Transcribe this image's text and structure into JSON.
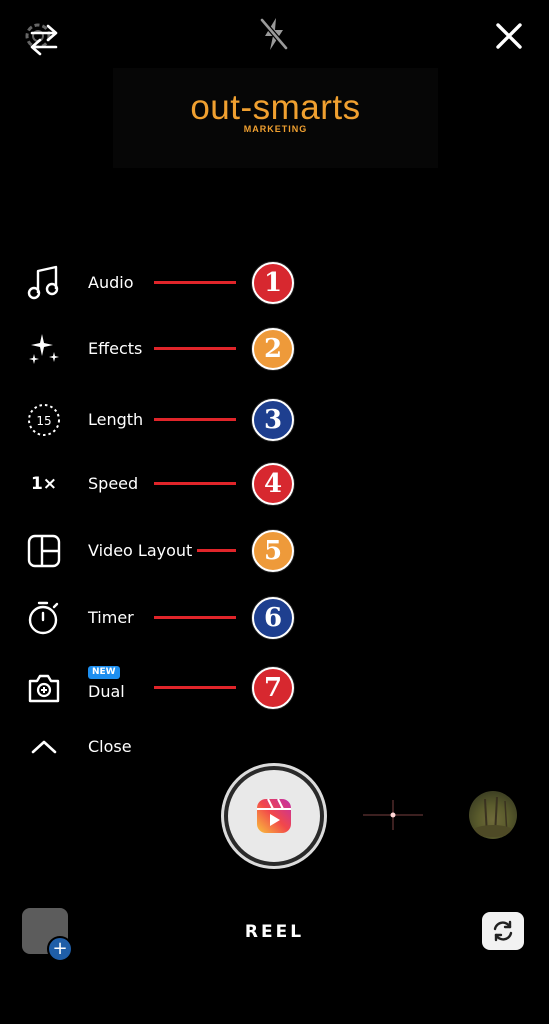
{
  "top_bar": {
    "settings_icon": "gear-icon",
    "swap_icon": "swap-arrows-icon",
    "flash_icon": "flash-off-icon",
    "close_icon": "close-icon"
  },
  "logo": {
    "brand_name": "out-smarts",
    "tagline": "MARKETING",
    "brand_color": "#F0A030"
  },
  "tools": [
    {
      "label": "Audio",
      "icon": "music-note-icon",
      "number": "1",
      "badge_color": "#D7282F"
    },
    {
      "label": "Effects",
      "icon": "sparkles-icon",
      "number": "2",
      "badge_color": "#EE9A3A"
    },
    {
      "label": "Length",
      "icon": "timer-15-icon",
      "icon_text": "15",
      "number": "3",
      "badge_color": "#1E3F8F"
    },
    {
      "label": "Speed",
      "icon": "speed-icon",
      "icon_text": "1×",
      "number": "4",
      "badge_color": "#D7282F"
    },
    {
      "label": "Video Layout",
      "icon": "layout-icon",
      "number": "5",
      "badge_color": "#EE9A3A"
    },
    {
      "label": "Timer",
      "icon": "stopwatch-icon",
      "number": "6",
      "badge_color": "#1E3F8F"
    },
    {
      "label": "Dual",
      "icon": "dual-camera-icon",
      "new_badge": "NEW",
      "number": "7",
      "badge_color": "#D7282F"
    }
  ],
  "close_toggle": {
    "label": "Close",
    "icon": "chevron-up-icon"
  },
  "capture": {
    "shutter_icon": "reels-icon"
  },
  "bottom_bar": {
    "mode": "REEL",
    "gallery_icon": "gallery-add-icon",
    "gallery_plus": "+",
    "flip_icon": "flip-camera-icon"
  },
  "colors": {
    "background": "#000000",
    "annotation_line": "#E0252A"
  }
}
